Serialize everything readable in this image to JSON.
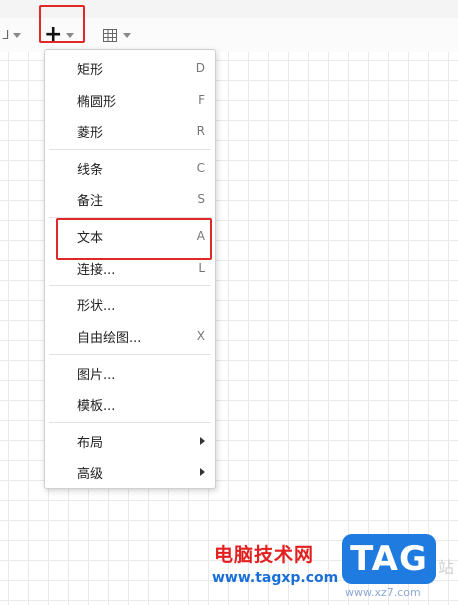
{
  "toolbar": {
    "plus_label": "+",
    "plus_icon": "plus-icon",
    "table_icon": "table-icon"
  },
  "menu": {
    "items": [
      {
        "label": "矩形",
        "shortcut": "D"
      },
      {
        "label": "椭圆形",
        "shortcut": "F"
      },
      {
        "label": "菱形",
        "shortcut": "R"
      },
      {
        "label": "线条",
        "shortcut": "C"
      },
      {
        "label": "备注",
        "shortcut": "S"
      },
      {
        "label": "文本",
        "shortcut": "A"
      },
      {
        "label": "连接...",
        "shortcut": "L"
      },
      {
        "label": "形状...",
        "shortcut": ""
      },
      {
        "label": "自由绘图...",
        "shortcut": "X"
      },
      {
        "label": "图片...",
        "shortcut": ""
      },
      {
        "label": "模板...",
        "shortcut": ""
      },
      {
        "label": "布局",
        "shortcut": ""
      },
      {
        "label": "高级",
        "shortcut": ""
      }
    ]
  },
  "watermark": {
    "site_name": "电脑技术网",
    "url": "www.tagxp.com",
    "logo": "TAG",
    "side_mark": "站",
    "under_text": "www.xz7.com"
  },
  "colors": {
    "highlight": "#e02828",
    "watermark_red": "#e32020",
    "watermark_blue": "#1f7be0"
  }
}
